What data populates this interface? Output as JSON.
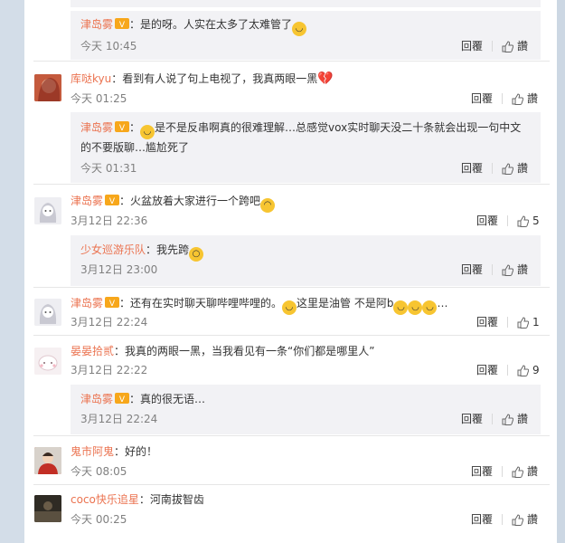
{
  "comments": [
    {
      "user": "津岛雾",
      "sep": "：",
      "text": "是的呀。人实在太多了太难管了",
      "time": "今天 10:45",
      "reply": "回覆",
      "like": "讚"
    },
    {
      "user": "库哒kyu",
      "sep": "：",
      "text": "看到有人说了句上电视了，我真两眼一黑",
      "time": "今天 01:25",
      "reply": "回覆",
      "like": "讚"
    },
    {
      "user": "津岛雾",
      "sep": "：",
      "text1": "是不是反串啊真的很难理解…总感觉vox实时聊天没二十条就会出现一句中文",
      "text2": "的不要版聊…尴尬死了",
      "time": "今天 01:31",
      "reply": "回覆",
      "like": "讚"
    },
    {
      "user": "津岛雾",
      "sep": "：",
      "text": "火盆放着大家进行一个跨吧",
      "time": "3月12日 22:36",
      "reply": "回覆",
      "like": "5"
    },
    {
      "user": "少女巡游乐队",
      "sep": "：",
      "text": "我先跨",
      "time": "3月12日 23:00",
      "reply": "回覆",
      "like": "讚"
    },
    {
      "user": "津岛雾",
      "sep": "：",
      "text": "还有在实时聊天聊哔哩哔哩的。",
      "text_b": "这里是油管 不是阿b",
      "time": "3月12日 22:24",
      "reply": "回覆",
      "like": "1"
    },
    {
      "user": "晏晏拾贰",
      "sep": "：",
      "text": "我真的两眼一黑，当我看见有一条“你们都是哪里人”",
      "time": "3月12日 22:22",
      "reply": "回覆",
      "like": "9"
    },
    {
      "user": "津岛雾",
      "sep": "：",
      "text": "真的很无语…",
      "time": "3月12日 22:24",
      "reply": "回覆",
      "like": "讚"
    },
    {
      "user": "鬼市阿鬼",
      "sep": "：",
      "text": "好的！",
      "time": "今天 08:05",
      "reply": "回覆",
      "like": "讚"
    },
    {
      "user": "coco快乐追星",
      "sep": "：",
      "text": "河南拔智齿",
      "time": "今天 00:25",
      "reply": "回覆",
      "like": "讚"
    }
  ],
  "colors": {
    "name": "#eb7350",
    "subbg": "#f2f2f5",
    "border": "#e6e6e6"
  }
}
